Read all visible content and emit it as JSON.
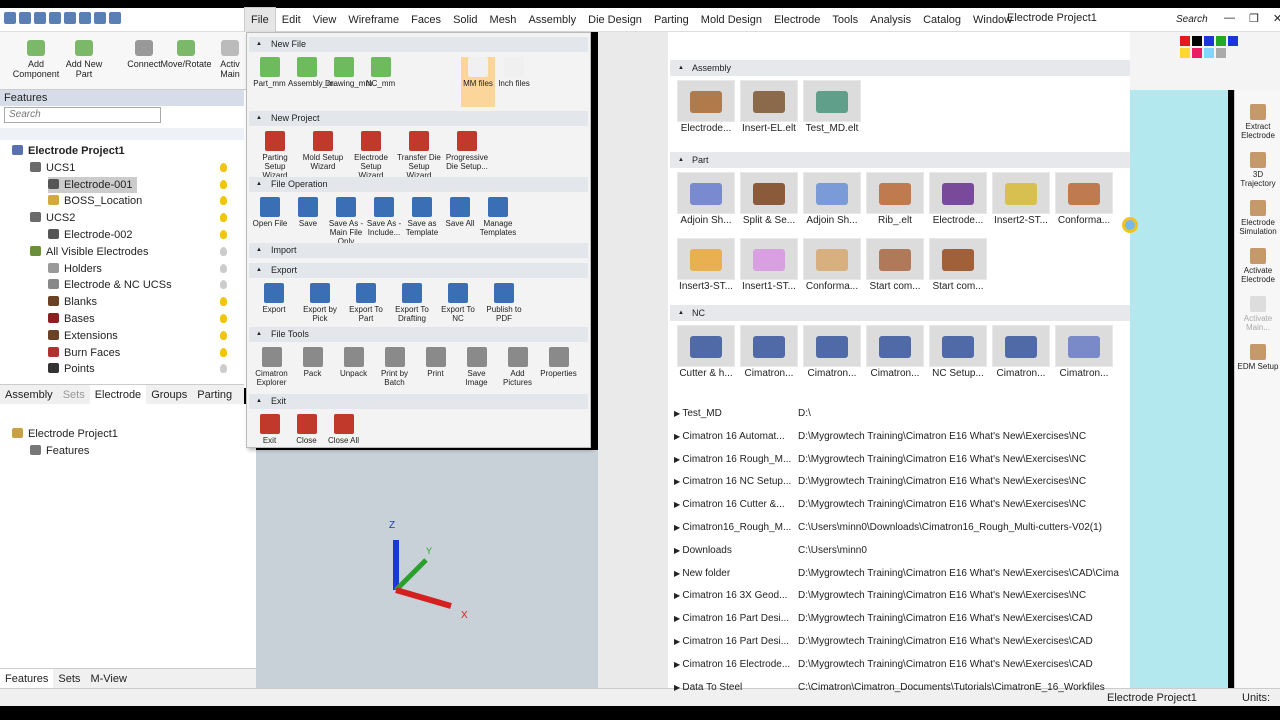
{
  "window": {
    "title": "Electrode Project1",
    "search_label": "Search",
    "controls": [
      "—",
      "❐",
      "✕"
    ]
  },
  "menubar": [
    "File",
    "Edit",
    "View",
    "Wireframe",
    "Faces",
    "Solid",
    "Mesh",
    "Assembly",
    "Die Design",
    "Parting",
    "Mold Design",
    "Electrode",
    "Tools",
    "Analysis",
    "Catalog",
    "Window"
  ],
  "ribbon": {
    "buttons": [
      "Add Component",
      "Add New Part",
      "Connect",
      "Move/Rotate",
      "Activ Main"
    ]
  },
  "features": {
    "header": "Features",
    "search_placeholder": "Search",
    "tree": [
      {
        "label": "Electrode Project1",
        "level": 0,
        "bold": true
      },
      {
        "label": "UCS1",
        "level": 1
      },
      {
        "label": "Electrode-001",
        "level": 2,
        "selected": true
      },
      {
        "label": "BOSS_Location",
        "level": 2
      },
      {
        "label": "UCS2",
        "level": 1
      },
      {
        "label": "Electrode-002",
        "level": 2
      },
      {
        "label": "All Visible Electrodes",
        "level": 1
      },
      {
        "label": "Holders",
        "level": 2
      },
      {
        "label": "Electrode & NC UCSs",
        "level": 2
      },
      {
        "label": "Blanks",
        "level": 2
      },
      {
        "label": "Bases",
        "level": 2
      },
      {
        "label": "Extensions",
        "level": 2
      },
      {
        "label": "Burn Faces",
        "level": 2
      },
      {
        "label": "Points",
        "level": 2
      }
    ],
    "tabs": [
      "Assembly",
      "Sets",
      "Electrode",
      "Groups",
      "Parting"
    ],
    "lower_tree": [
      {
        "label": "Electrode Project1"
      },
      {
        "label": "Features"
      }
    ],
    "bottom_tabs": [
      "Features",
      "Sets",
      "M-View"
    ]
  },
  "file_menu": {
    "sections": [
      {
        "title": "New File",
        "items": [
          "Part_mm",
          "Assembly_m...",
          "Drawing_mm",
          "NC_mm",
          "MM files",
          "Inch files"
        ]
      },
      {
        "title": "New Project",
        "items": [
          "Parting Setup Wizard",
          "Mold Setup Wizard",
          "Electrode Setup Wizard",
          "Transfer Die Setup Wizard",
          "Progressive Die Setup..."
        ]
      },
      {
        "title": "File Operation",
        "items": [
          "Open File",
          "Save",
          "Save As - Main File Only",
          "Save As - Include...",
          "Save as Template",
          "Save All",
          "Manage Templates"
        ]
      },
      {
        "title": "Import",
        "items": []
      },
      {
        "title": "Export",
        "items": [
          "Export",
          "Export by Pick",
          "Export To Part",
          "Export To Drafting",
          "Export To NC",
          "Publish to PDF"
        ]
      },
      {
        "title": "File Tools",
        "items": [
          "Cimatron Explorer",
          "Pack",
          "Unpack",
          "Print by Batch",
          "Print",
          "Save Image",
          "Add Pictures",
          "Properties"
        ]
      },
      {
        "title": "Exit",
        "items": [
          "Exit",
          "Close",
          "Close All"
        ]
      }
    ]
  },
  "catalog": {
    "sections": [
      {
        "title": "Assembly",
        "cards": [
          "Electrode...",
          "Insert-EL.elt",
          "Test_MD.elt"
        ]
      },
      {
        "title": "Part",
        "cards": [
          "Adjoin Sh...",
          "Split & Se...",
          "Adjoin Sh...",
          "Rib_.elt",
          "Electrode...",
          "Insert2-ST...",
          "Conforma...",
          "Insert3-ST...",
          "Insert1-ST...",
          "Conforma...",
          "Start com...",
          "Start com..."
        ]
      },
      {
        "title": "NC",
        "cards": [
          "Cutter & h...",
          "Cimatron...",
          "Cimatron...",
          "Cimatron...",
          "NC Setup...",
          "Cimatron...",
          "Cimatron..."
        ]
      }
    ],
    "recent": [
      {
        "name": "Test_MD",
        "path": "D:\\"
      },
      {
        "name": "Cimatron 16 Automat...",
        "path": "D:\\Mygrowtech Training\\Cimatron E16 What's New\\Exercises\\NC"
      },
      {
        "name": "Cimatron 16 Rough_M...",
        "path": "D:\\Mygrowtech Training\\Cimatron E16 What's New\\Exercises\\NC"
      },
      {
        "name": "Cimatron 16 NC Setup...",
        "path": "D:\\Mygrowtech Training\\Cimatron E16 What's New\\Exercises\\NC"
      },
      {
        "name": "Cimatron 16 Cutter &...",
        "path": "D:\\Mygrowtech Training\\Cimatron E16 What's New\\Exercises\\NC"
      },
      {
        "name": "Cimatron16_Rough_M...",
        "path": "C:\\Users\\minn0\\Downloads\\Cimatron16_Rough_Multi-cutters-V02(1)"
      },
      {
        "name": "Downloads",
        "path": "C:\\Users\\minn0"
      },
      {
        "name": "New folder",
        "path": "D:\\Mygrowtech Training\\Cimatron E16 What's New\\Exercises\\CAD\\Cima"
      },
      {
        "name": "Cimatron 16 3X Geod...",
        "path": "D:\\Mygrowtech Training\\Cimatron E16 What's New\\Exercises\\NC"
      },
      {
        "name": "Cimatron 16 Part Desi...",
        "path": "D:\\Mygrowtech Training\\Cimatron E16 What's New\\Exercises\\CAD"
      },
      {
        "name": "Cimatron 16 Part Desi...",
        "path": "D:\\Mygrowtech Training\\Cimatron E16 What's New\\Exercises\\CAD"
      },
      {
        "name": "Cimatron 16 Electrode...",
        "path": "D:\\Mygrowtech Training\\Cimatron E16 What's New\\Exercises\\CAD"
      },
      {
        "name": "Data To Steel",
        "path": "C:\\Cimatron\\Cimatron_Documents\\Tutorials\\CimatronE_16_Workfiles"
      }
    ]
  },
  "right_panel": [
    "Extract Electrode",
    "3D Trajectory",
    "Electrode Simulation",
    "Activate Electrode",
    "Activate Main...",
    "EDM Setup"
  ],
  "status": {
    "project": "Electrode Project1",
    "units": "Units: m"
  },
  "axes": {
    "z": "Z",
    "y": "Y",
    "x": "X"
  }
}
